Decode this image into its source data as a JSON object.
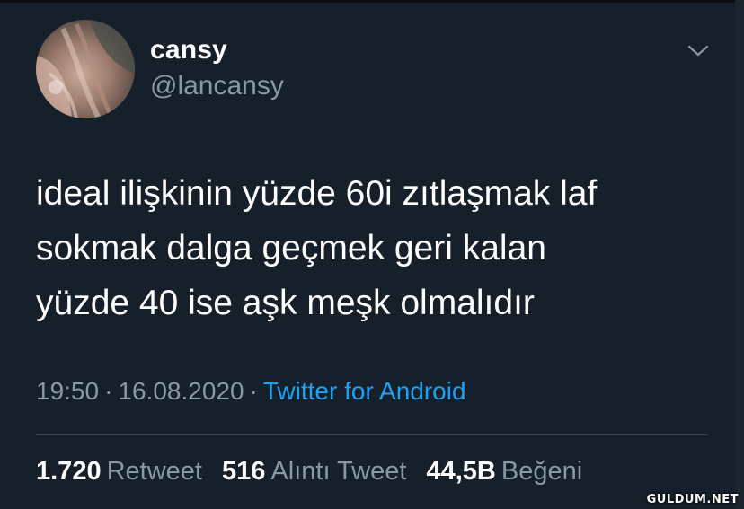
{
  "user": {
    "display_name": "cansy",
    "handle": "@lancansy"
  },
  "tweet": {
    "lines": [
      "ideal ilişkinin yüzde 60i zıtlaşmak laf",
      "sokmak dalga geçmek geri kalan",
      "yüzde 40 ise aşk meşk olmalıdır"
    ],
    "time": "19:50",
    "date": "16.08.2020",
    "separator": "·",
    "source": "Twitter for Android"
  },
  "stats": {
    "retweets": {
      "count": "1.720",
      "label": "Retweet"
    },
    "quotes": {
      "count": "516",
      "label": "Alıntı Tweet"
    },
    "likes": {
      "count": "44,5B",
      "label": "Beğeni"
    }
  },
  "watermark": "GULDUM.NET",
  "colors": {
    "background": "#15202b",
    "text": "#ffffff",
    "secondary_text": "#8899a6",
    "link": "#1da1f2",
    "divider": "#38444d"
  },
  "icons": {
    "menu": "chevron-down-icon"
  }
}
